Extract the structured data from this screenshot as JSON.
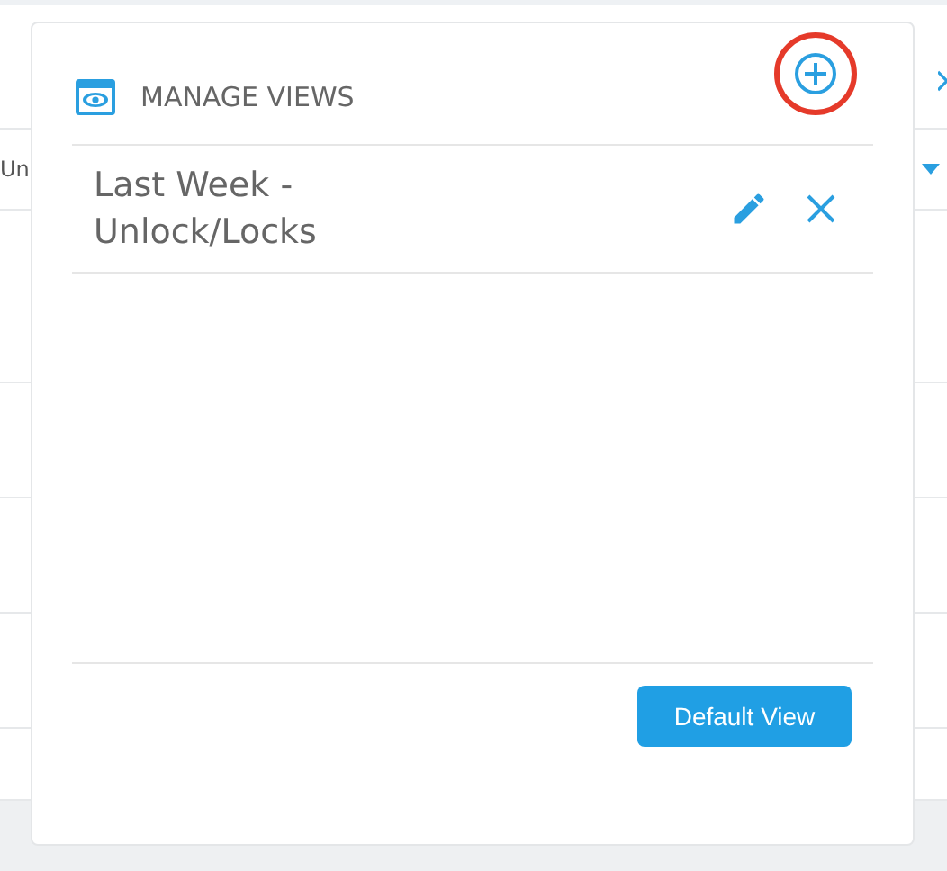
{
  "background_table": {
    "cell_text": "Un"
  },
  "panel": {
    "title": "MANAGE VIEWS",
    "views": [
      {
        "name": "Last Week - Unlock/Locks"
      }
    ],
    "button": "Default View"
  }
}
